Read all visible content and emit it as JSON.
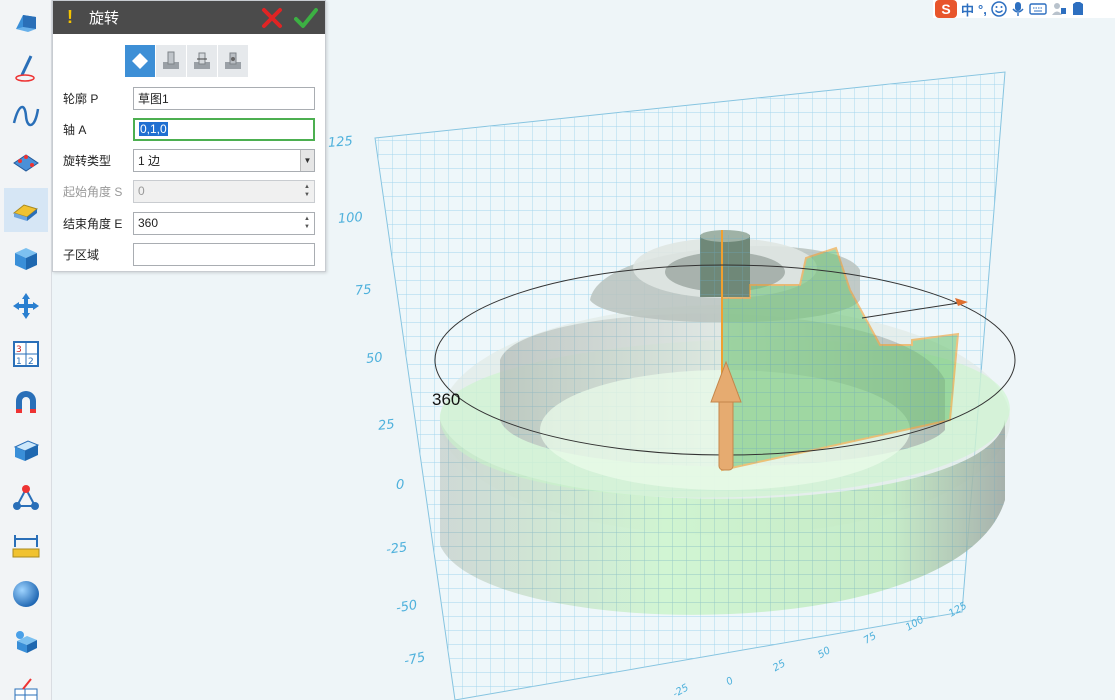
{
  "dialog": {
    "title": "旋转",
    "warning_glyph": "!",
    "fields": {
      "profile": {
        "label": "轮廓 P",
        "value": "草图1"
      },
      "axis": {
        "label": "轴 A",
        "value": "0,1,0"
      },
      "type": {
        "label": "旋转类型",
        "value": "1 边"
      },
      "start_angle": {
        "label": "起始角度 S",
        "value": "0"
      },
      "end_angle": {
        "label": "结束角度 E",
        "value": "360"
      },
      "subregion": {
        "label": "子区域",
        "value": ""
      }
    }
  },
  "viewport": {
    "angle_label": "360",
    "z_ticks": [
      "125",
      "100",
      "75",
      "50",
      "25",
      "0",
      "-25",
      "-50",
      "-75"
    ],
    "x_ticks": [
      "-25",
      "0",
      "25",
      "50",
      "75",
      "100",
      "125"
    ]
  },
  "ime": {
    "logo": "S",
    "lang": "中",
    "punct": "°,"
  },
  "colors": {
    "grid": "#9fd3ec",
    "part_green": "#b5e8b5",
    "part_gray": "#bfc7c2",
    "profile_orange": "#f0a030",
    "arrow": "#e6ab70",
    "title_bar": "#4b4b4b"
  },
  "toolbar": {
    "icons": [
      "solid-cube-icon",
      "sketch-pencil-icon",
      "curve-icon",
      "surface-icon",
      "feature-edit-icon",
      "box-primitive-icon",
      "move-arrows-icon",
      "pattern-grid-icon",
      "magnet-icon",
      "shell-icon",
      "graph-nodes-icon",
      "measure-icon",
      "sphere-icon",
      "assembly-icon",
      "drawing-icon"
    ]
  }
}
